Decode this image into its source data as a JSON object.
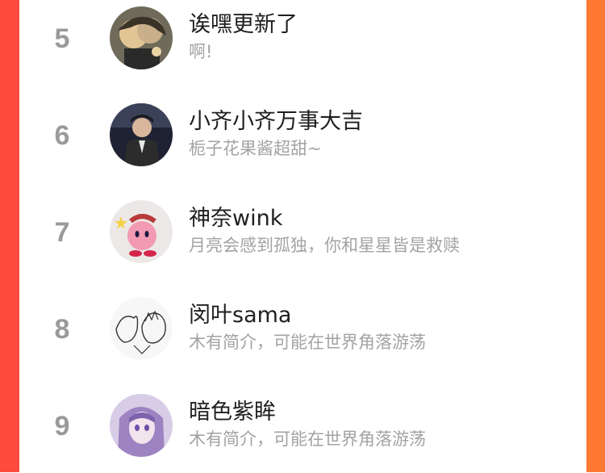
{
  "colors": {
    "background_start": "#ff4a3f",
    "background_end": "#ff7a34",
    "rank_number": "#9a9a9a",
    "name_text": "#1f1f1f",
    "bio_text": "#a3a3a3"
  },
  "ranking": {
    "entries": [
      {
        "rank": "5",
        "name": "诶嘿更新了",
        "bio": "啊!",
        "avatar_icon": "anime-avatar-icon"
      },
      {
        "rank": "6",
        "name": "小齐小齐万事大吉",
        "bio": "栀子花果酱超甜~",
        "avatar_icon": "person-photo-avatar-icon"
      },
      {
        "rank": "7",
        "name": "神奈wink",
        "bio": "月亮会感到孤独，你和星星皆是救赎",
        "avatar_icon": "kirby-avatar-icon"
      },
      {
        "rank": "8",
        "name": "闵叶sama",
        "bio": "木有简介，可能在世界角落游荡",
        "avatar_icon": "sketch-avatar-icon"
      },
      {
        "rank": "9",
        "name": "暗色紫眸",
        "bio": "木有简介，可能在世界角落游荡",
        "avatar_icon": "purple-anime-avatar-icon"
      }
    ]
  }
}
